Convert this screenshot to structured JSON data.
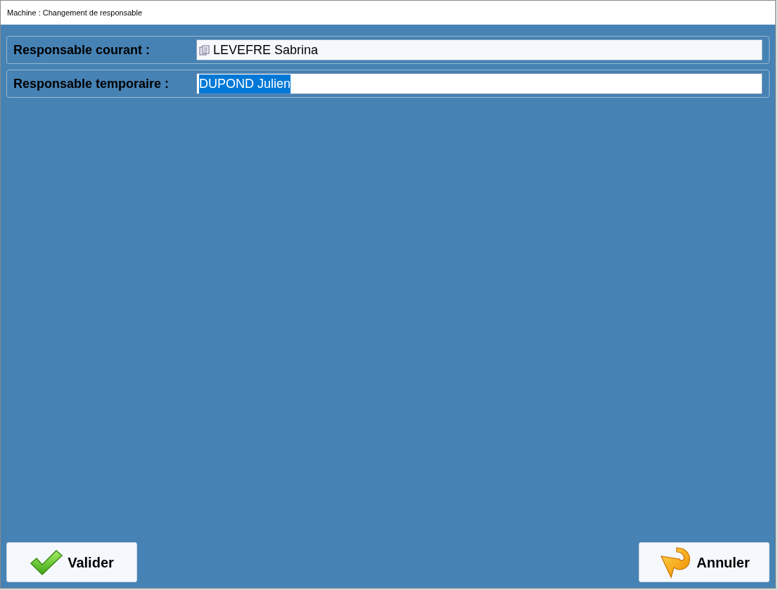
{
  "window": {
    "title": "Machine : Changement de responsable"
  },
  "fields": [
    {
      "label": "Responsable courant :",
      "value": "LEVEFRE Sabrina",
      "kind": "readonly",
      "text_selected": false
    },
    {
      "label": "Responsable temporaire :",
      "value": "DUPOND Julien",
      "kind": "editable",
      "text_selected": true
    }
  ],
  "buttons": [
    {
      "label": "Valider",
      "kind": "ok"
    },
    {
      "label": "Annuler",
      "kind": "cancel"
    }
  ]
}
